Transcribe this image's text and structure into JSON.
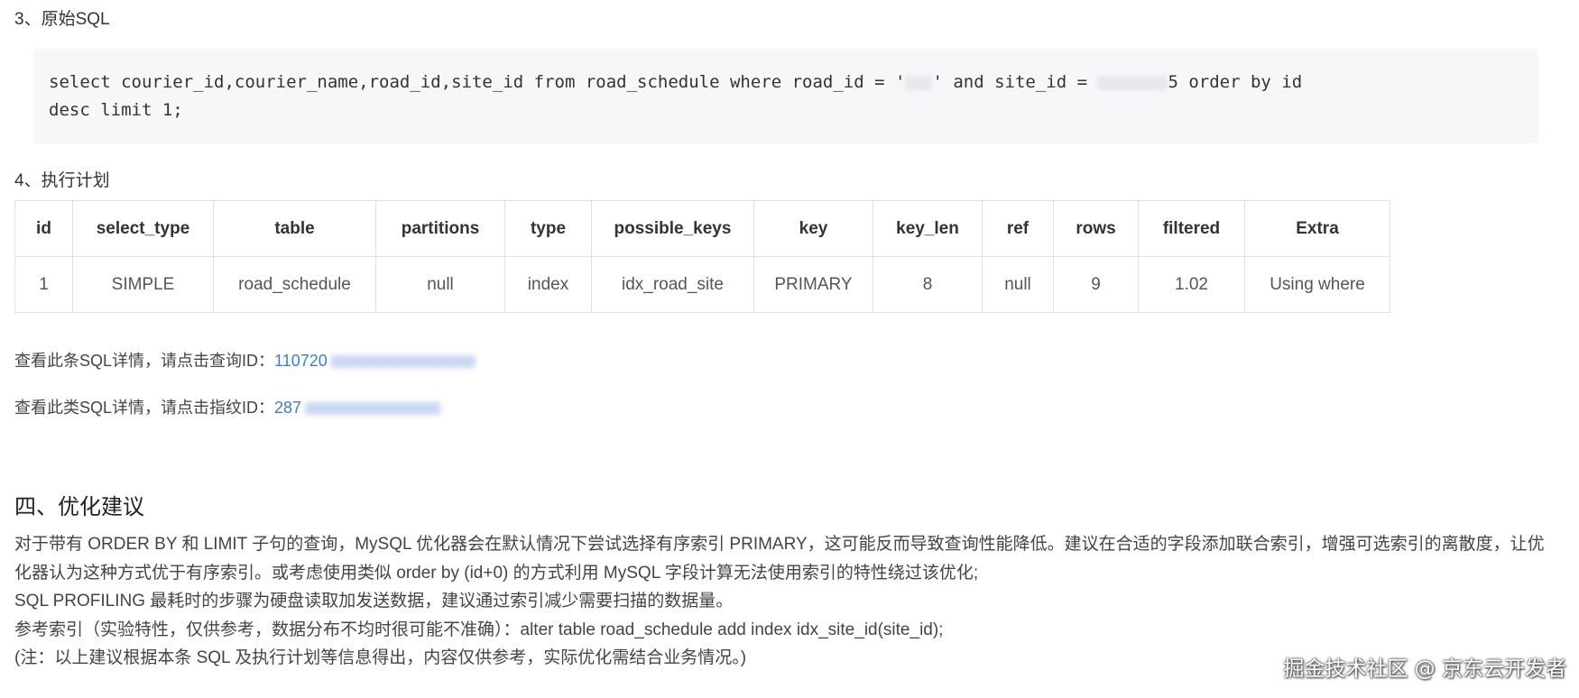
{
  "sections": {
    "sql_title": "3、原始SQL",
    "plan_title": "4、执行计划"
  },
  "sql": {
    "line1_a": "select courier_id,courier_name,road_id,site_id from road_schedule where road_id = '",
    "line1_b": "' and site_id = ",
    "line1_c": "5 order by id",
    "line2": "desc limit 1;"
  },
  "plan_table": {
    "headers": [
      "id",
      "select_type",
      "table",
      "partitions",
      "type",
      "possible_keys",
      "key",
      "key_len",
      "ref",
      "rows",
      "filtered",
      "Extra"
    ],
    "rows": [
      [
        "1",
        "SIMPLE",
        "road_schedule",
        "null",
        "index",
        "idx_road_site",
        "PRIMARY",
        "8",
        "null",
        "9",
        "1.02",
        "Using where"
      ]
    ]
  },
  "links": {
    "query_label": "查看此条SQL详情，请点击查询ID：",
    "query_id": "110720",
    "fingerprint_label": "查看此类SQL详情，请点击指纹ID：",
    "fingerprint_id": "287"
  },
  "optimization": {
    "title": "四、优化建议",
    "p1": "对于带有 ORDER BY 和 LIMIT 子句的查询，MySQL 优化器会在默认情况下尝试选择有序索引 PRIMARY，这可能反而导致查询性能降低。建议在合适的字段添加联合索引，增强可选索引的离散度，让优化器认为这种方式优于有序索引。或考虑使用类似 order by (id+0) 的方式利用 MySQL 字段计算无法使用索引的特性绕过该优化;",
    "p2": "SQL PROFILING 最耗时的步骤为硬盘读取加发送数据，建议通过索引减少需要扫描的数据量。",
    "p3": "参考索引（实验特性，仅供参考，数据分布不均时很可能不准确）：alter table road_schedule add index idx_site_id(site_id);",
    "p4": "(注：以上建议根据本条 SQL 及执行计划等信息得出，内容仅供参考，实际优化需结合业务情况。)"
  },
  "watermark": "掘金技术社区 @ 京东云开发者"
}
